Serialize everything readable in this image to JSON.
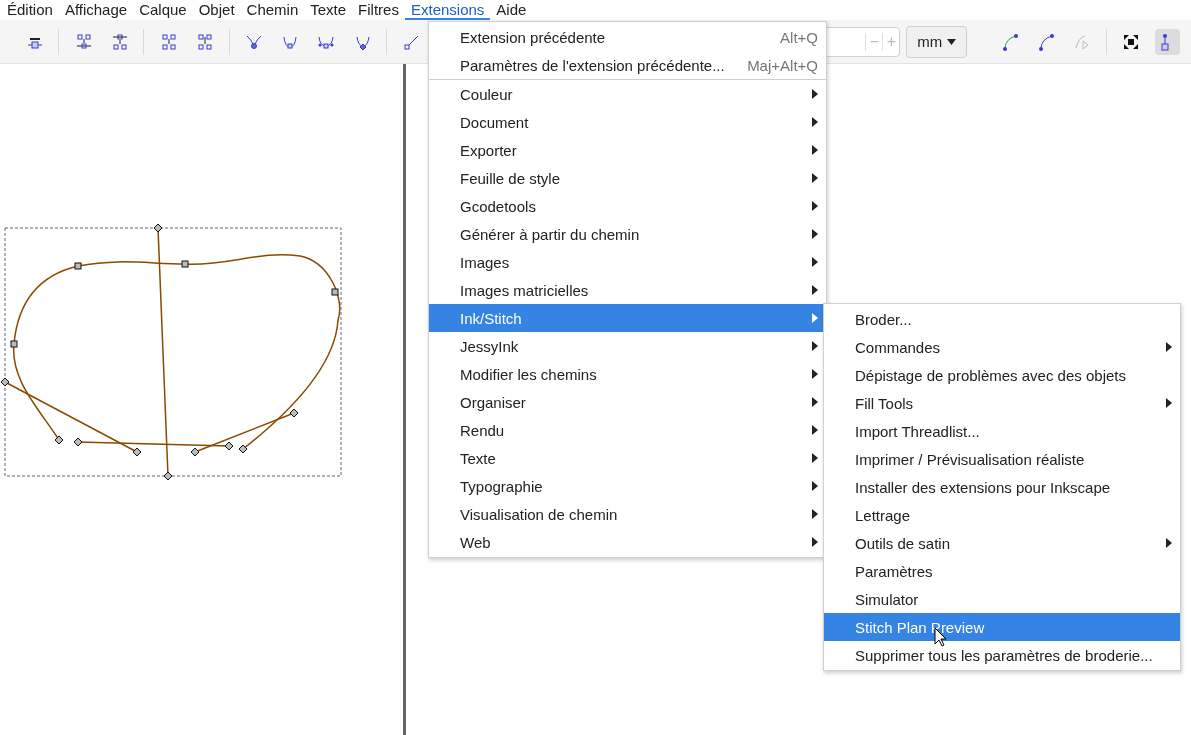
{
  "menubar": [
    {
      "label": "Édition",
      "selected": false
    },
    {
      "label": "Affichage",
      "selected": false
    },
    {
      "label": "Calque",
      "selected": false
    },
    {
      "label": "Objet",
      "selected": false
    },
    {
      "label": "Chemin",
      "selected": false
    },
    {
      "label": "Texte",
      "selected": false
    },
    {
      "label": "Filtres",
      "selected": false
    },
    {
      "label": "Extensions",
      "selected": true
    },
    {
      "label": "Aide",
      "selected": false
    }
  ],
  "toolbar": {
    "decrement": "−",
    "increment": "+",
    "unit": "mm"
  },
  "extensions_menu": [
    {
      "label": "Extension précédente",
      "shortcut": "Alt+Q",
      "submenu": false,
      "selected": false,
      "separator_after": false
    },
    {
      "label": "Paramètres de l'extension précédente...",
      "shortcut": "Maj+Alt+Q",
      "submenu": false,
      "selected": false,
      "separator_after": true
    },
    {
      "label": "Couleur",
      "submenu": true,
      "selected": false,
      "separator_after": false
    },
    {
      "label": "Document",
      "submenu": true,
      "selected": false,
      "separator_after": false
    },
    {
      "label": "Exporter",
      "submenu": true,
      "selected": false,
      "separator_after": false
    },
    {
      "label": "Feuille de style",
      "submenu": true,
      "selected": false,
      "separator_after": false
    },
    {
      "label": "Gcodetools",
      "submenu": true,
      "selected": false,
      "separator_after": false
    },
    {
      "label": "Générer à partir du chemin",
      "submenu": true,
      "selected": false,
      "separator_after": false
    },
    {
      "label": "Images",
      "submenu": true,
      "selected": false,
      "separator_after": false
    },
    {
      "label": "Images matricielles",
      "submenu": true,
      "selected": false,
      "separator_after": false
    },
    {
      "label": "Ink/Stitch",
      "submenu": true,
      "selected": true,
      "separator_after": false
    },
    {
      "label": "JessyInk",
      "submenu": true,
      "selected": false,
      "separator_after": false
    },
    {
      "label": "Modifier les chemins",
      "submenu": true,
      "selected": false,
      "separator_after": false
    },
    {
      "label": "Organiser",
      "submenu": true,
      "selected": false,
      "separator_after": false
    },
    {
      "label": "Rendu",
      "submenu": true,
      "selected": false,
      "separator_after": false
    },
    {
      "label": "Texte",
      "submenu": true,
      "selected": false,
      "separator_after": false
    },
    {
      "label": "Typographie",
      "submenu": true,
      "selected": false,
      "separator_after": false
    },
    {
      "label": "Visualisation de chemin",
      "submenu": true,
      "selected": false,
      "separator_after": false
    },
    {
      "label": "Web",
      "submenu": true,
      "selected": false,
      "separator_after": false
    }
  ],
  "inkstitch_submenu": [
    {
      "label": "Broder...",
      "submenu": false,
      "selected": false
    },
    {
      "label": "Commandes",
      "submenu": true,
      "selected": false
    },
    {
      "label": "Dépistage de problèmes avec des objets",
      "submenu": false,
      "selected": false
    },
    {
      "label": "Fill Tools",
      "submenu": true,
      "selected": false
    },
    {
      "label": "Import Threadlist...",
      "submenu": false,
      "selected": false
    },
    {
      "label": "Imprimer / Prévisualisation réaliste",
      "submenu": false,
      "selected": false
    },
    {
      "label": "Installer des extensions pour Inkscape",
      "submenu": false,
      "selected": false
    },
    {
      "label": "Lettrage",
      "submenu": false,
      "selected": false
    },
    {
      "label": "Outils de satin",
      "submenu": true,
      "selected": false
    },
    {
      "label": "Paramètres",
      "submenu": false,
      "selected": false
    },
    {
      "label": "Simulator",
      "submenu": false,
      "selected": false
    },
    {
      "label": "Stitch Plan Preview",
      "submenu": false,
      "selected": true
    },
    {
      "label": "Supprimer tous les paramètres de broderie...",
      "submenu": false,
      "selected": false
    }
  ]
}
